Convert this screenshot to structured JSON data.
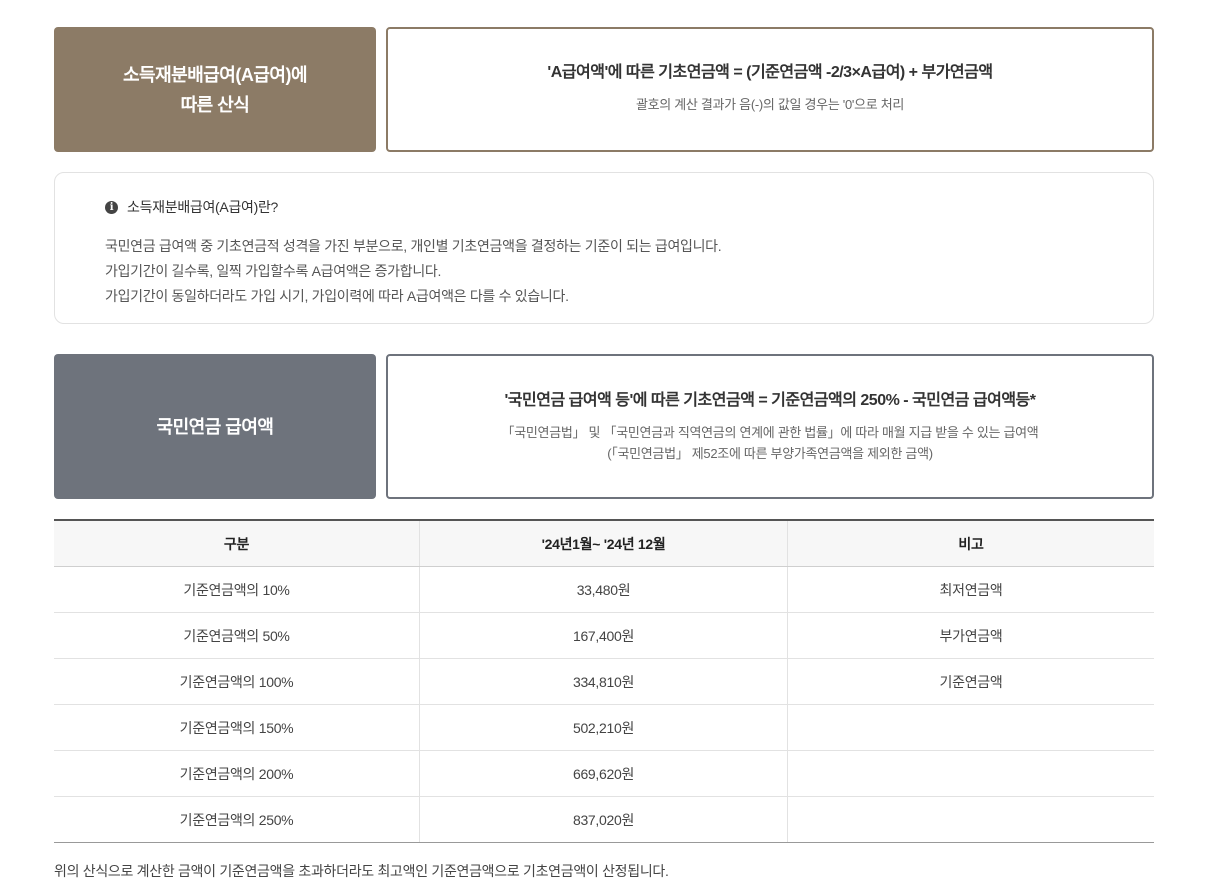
{
  "section_a": {
    "label_line1": "소득재분배급여(A급여)에",
    "label_line2": "따른 산식",
    "formula": "'A급여액'에 따른 기초연금액 = (기준연금액 -2/3×A급여) + 부가연금액",
    "note": "괄호의 계산 결과가 음(-)의 값일 경우는 '0'으로 처리"
  },
  "info": {
    "title": "소득재분배급여(A급여)란?",
    "icon": "info-circle-icon",
    "lines": [
      "국민연금 급여액 중 기초연금적 성격을 가진 부분으로, 개인별 기초연금액을 결정하는 기준이 되는 급여입니다.",
      "가입기간이 길수록, 일찍 가입할수록 A급여액은 증가합니다.",
      "가입기간이 동일하더라도 가입 시기, 가입이력에 따라 A급여액은 다를 수 있습니다."
    ]
  },
  "section_n": {
    "label": "국민연금 급여액",
    "formula": "'국민연금 급여액 등'에 따른 기초연금액 = 기준연금액의 250% - 국민연금 급여액등*",
    "note_line1": "「국민연금법」 및 「국민연금과 직역연금의 연계에 관한 법률」에 따라 매월 지급 받을 수 있는 급여액",
    "note_line2": "(「국민연금법」 제52조에 따른 부양가족연금액을 제외한 금액)"
  },
  "table": {
    "headers": [
      "구분",
      "'24년1월~ '24년 12월",
      "비고"
    ],
    "rows": [
      [
        "기준연금액의 10%",
        "33,480원",
        "최저연금액"
      ],
      [
        "기준연금액의 50%",
        "167,400원",
        "부가연금액"
      ],
      [
        "기준연금액의 100%",
        "334,810원",
        "기준연금액"
      ],
      [
        "기준연금액의 150%",
        "502,210원",
        ""
      ],
      [
        "기준연금액의 200%",
        "669,620원",
        ""
      ],
      [
        "기준연금액의 250%",
        "837,020원",
        ""
      ]
    ]
  },
  "footnote": "위의 산식으로 계산한 금액이 기준연금액을 초과하더라도 최고액인 기준연금액으로 기초연금액이 산정됩니다.",
  "colors": {
    "section_a_accent": "#8c7b66",
    "section_n_accent": "#6e737c"
  }
}
